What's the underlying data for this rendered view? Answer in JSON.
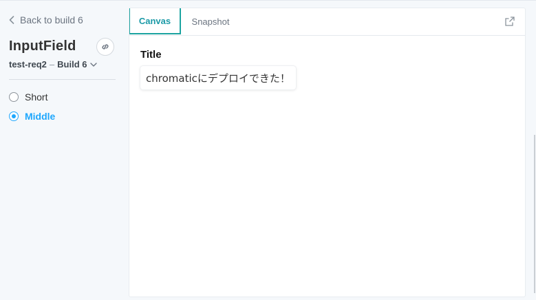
{
  "sidebar": {
    "back_label": "Back to build 6",
    "component_name": "InputField",
    "branch": "test-req2",
    "separator": "–",
    "build": "Build 6",
    "stories": [
      {
        "label": "Short",
        "selected": false
      },
      {
        "label": "Middle",
        "selected": true
      }
    ]
  },
  "tabs": [
    {
      "label": "Canvas",
      "active": true
    },
    {
      "label": "Snapshot",
      "active": false
    }
  ],
  "canvas": {
    "label": "Title",
    "input_value": "chromaticにデプロイできた！"
  },
  "icons": {
    "back": "chevron-left-icon",
    "link": "link-icon",
    "build_dropdown": "chevron-down-icon",
    "popout": "external-link-icon"
  },
  "colors": {
    "accent": "#1ea7fd",
    "tab_active": "#1ba3a0",
    "background": "#f5f8fb"
  }
}
